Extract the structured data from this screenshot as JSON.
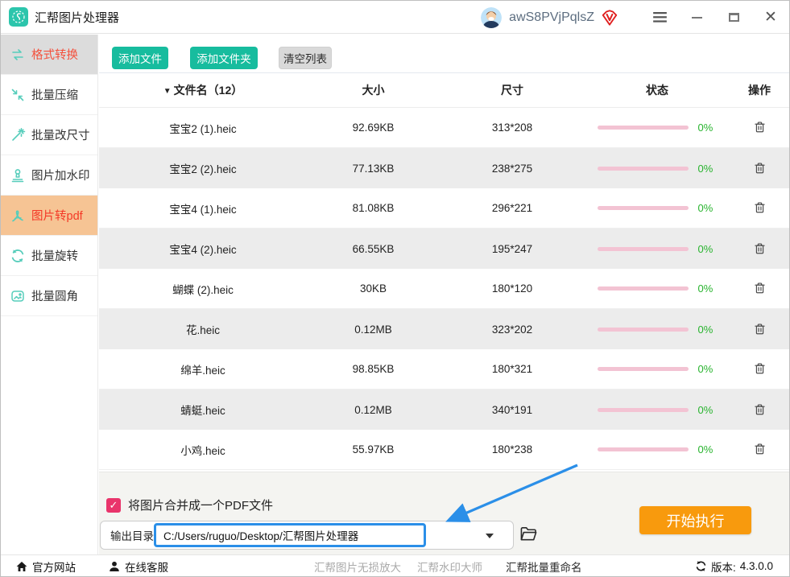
{
  "titlebar": {
    "app_title": "汇帮图片处理器",
    "username": "awS8PVjPqlsZ"
  },
  "sidebar": {
    "items": [
      {
        "label": "格式转换",
        "icon": "format-convert-icon",
        "state": "highlight"
      },
      {
        "label": "批量压缩",
        "icon": "compress-icon",
        "state": "normal"
      },
      {
        "label": "批量改尺寸",
        "icon": "resize-icon",
        "state": "normal"
      },
      {
        "label": "图片加水印",
        "icon": "watermark-icon",
        "state": "normal"
      },
      {
        "label": "图片转pdf",
        "icon": "pdf-icon",
        "state": "active"
      },
      {
        "label": "批量旋转",
        "icon": "rotate-icon",
        "state": "normal"
      },
      {
        "label": "批量圆角",
        "icon": "round-corner-icon",
        "state": "normal"
      }
    ]
  },
  "toolbar": {
    "add_file": "添加文件",
    "add_folder": "添加文件夹",
    "clear_list": "清空列表"
  },
  "table": {
    "headers": {
      "name": "文件名（12）",
      "size": "大小",
      "dimension": "尺寸",
      "status": "状态",
      "action": "操作"
    },
    "file_count": 12,
    "rows": [
      {
        "name": "宝宝2 (1).heic",
        "size": "92.69KB",
        "dimension": "313*208",
        "percent": "0%"
      },
      {
        "name": "宝宝2 (2).heic",
        "size": "77.13KB",
        "dimension": "238*275",
        "percent": "0%"
      },
      {
        "name": "宝宝4 (1).heic",
        "size": "81.08KB",
        "dimension": "296*221",
        "percent": "0%"
      },
      {
        "name": "宝宝4 (2).heic",
        "size": "66.55KB",
        "dimension": "195*247",
        "percent": "0%"
      },
      {
        "name": "蝴蝶 (2).heic",
        "size": "30KB",
        "dimension": "180*120",
        "percent": "0%"
      },
      {
        "name": "花.heic",
        "size": "0.12MB",
        "dimension": "323*202",
        "percent": "0%"
      },
      {
        "name": "绵羊.heic",
        "size": "98.85KB",
        "dimension": "180*321",
        "percent": "0%"
      },
      {
        "name": "蜻蜓.heic",
        "size": "0.12MB",
        "dimension": "340*191",
        "percent": "0%"
      },
      {
        "name": "小鸡.heic",
        "size": "55.97KB",
        "dimension": "180*238",
        "percent": "0%"
      }
    ]
  },
  "bottom": {
    "merge_checkbox_label": "将图片合并成一个PDF文件",
    "merge_checked": true,
    "output_label": "输出目录:",
    "output_path": "C:/Users/ruguo/Desktop/汇帮图片处理器",
    "start_button": "开始执行"
  },
  "footer": {
    "official_site": "官方网站",
    "online_service": "在线客服",
    "links": [
      "汇帮图片无损放大",
      "汇帮水印大师",
      "汇帮批量重命名"
    ],
    "version_label": "版本:",
    "version": "4.3.0.0"
  },
  "colors": {
    "teal": "#17bc9e",
    "sidebar_active_bg": "#f6c494",
    "sidebar_highlight_bg": "#dcdcdc",
    "red_text": "#f43826",
    "progress_pink": "#f3c3d3",
    "percent_green": "#28b42e",
    "start_orange": "#f89a0d",
    "checkbox_pink": "#e9346b",
    "annotation_blue": "#2b8fe8"
  }
}
